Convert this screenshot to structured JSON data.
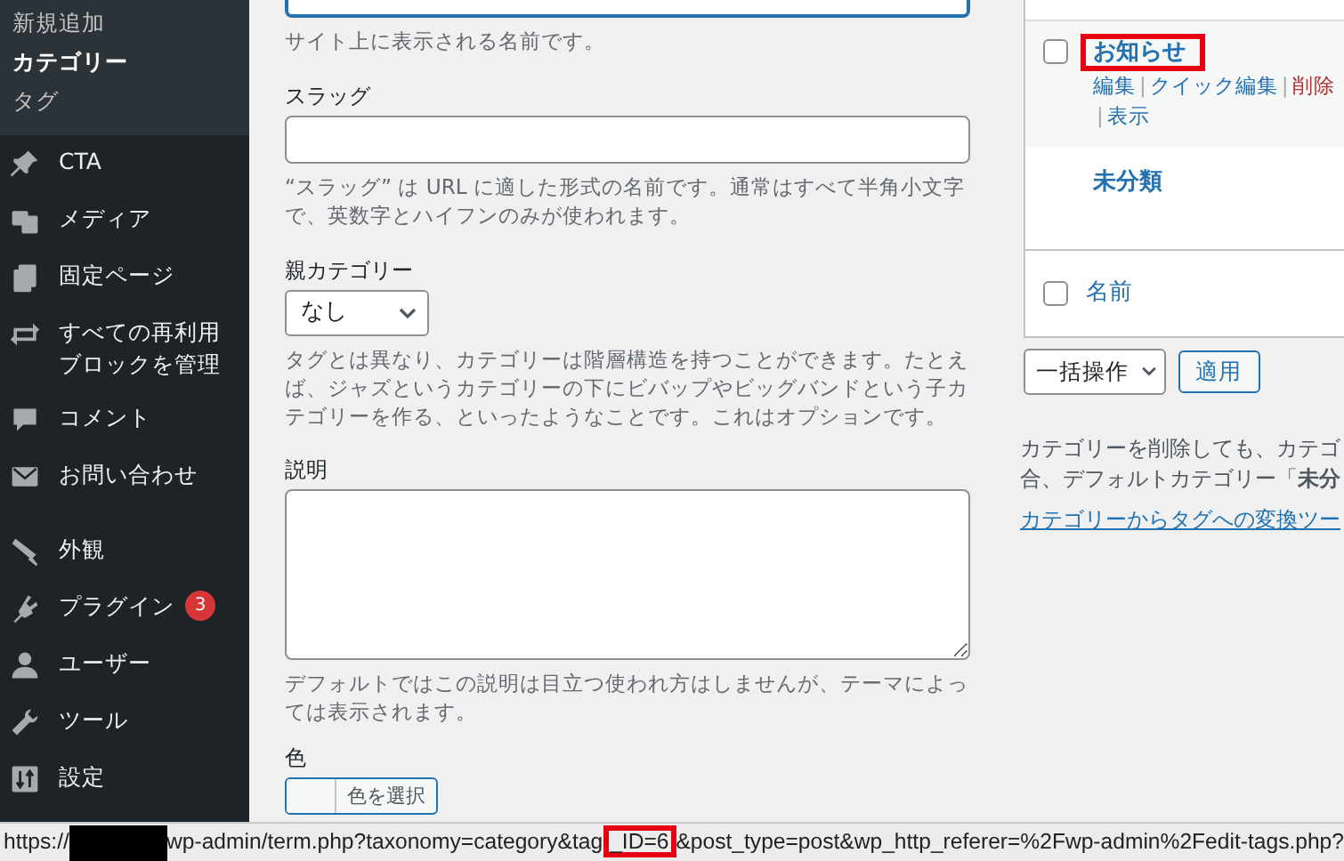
{
  "sidebar": {
    "submenu": [
      {
        "label": "新規追加",
        "selected": false
      },
      {
        "label": "カテゴリー",
        "selected": true
      },
      {
        "label": "タグ",
        "selected": false
      }
    ],
    "menu_groups": [
      [
        {
          "kind": "pin",
          "label": "CTA"
        },
        {
          "kind": "media",
          "label": "メディア"
        },
        {
          "kind": "pages",
          "label": "固定ページ"
        },
        {
          "kind": "blocks",
          "label": "すべての再利用ブロックを管理"
        },
        {
          "kind": "comment",
          "label": "コメント"
        },
        {
          "kind": "mail",
          "label": "お問い合わせ"
        }
      ],
      [
        {
          "kind": "brush",
          "label": "外観"
        },
        {
          "kind": "plug",
          "label": "プラグイン",
          "badge": "3"
        },
        {
          "kind": "user",
          "label": "ユーザー"
        },
        {
          "kind": "wrench",
          "label": "ツール"
        },
        {
          "kind": "settings",
          "label": "設定"
        }
      ]
    ]
  },
  "form": {
    "name_hint": "サイト上に表示される名前です。",
    "slug": {
      "label": "スラッグ",
      "hint": "“スラッグ” は URL に適した形式の名前です。通常はすべて半角小文字で、英数字とハイフンのみが使われます。"
    },
    "parent": {
      "label": "親カテゴリー",
      "value": "なし",
      "hint": "タグとは異なり、カテゴリーは階層構造を持つことができます。たとえば、ジャズというカテゴリーの下にビバップやビッグバンドという子カテゴリーを作る、といったようなことです。これはオプションです。"
    },
    "description": {
      "label": "説明",
      "hint": "デフォルトではこの説明は目立つ使われ方はしませんが、テーマによっては表示されます。"
    },
    "color": {
      "label": "色",
      "button": "色を選択"
    }
  },
  "table": {
    "rows": [
      {
        "name": "お知らせ",
        "checked": false,
        "highlighted": true,
        "action_lines": [
          [
            {
              "kind": "link",
              "label": "編集"
            },
            {
              "kind": "separator",
              "label": "|"
            },
            {
              "kind": "link",
              "label": "クイック編集"
            },
            {
              "kind": "separator",
              "label": "|"
            },
            {
              "kind": "delete",
              "label": "削除"
            }
          ],
          [
            {
              "kind": "separator",
              "label": "|"
            },
            {
              "kind": "link",
              "label": "表示"
            }
          ]
        ]
      },
      {
        "name": "未分類",
        "highlighted": false,
        "action_lines": []
      }
    ],
    "footer": {
      "label": "名前",
      "checked": false
    }
  },
  "bulk": {
    "select": "一括操作",
    "apply": "適用"
  },
  "note": {
    "line_1": "カテゴリーを削除しても、カテゴ",
    "line_2": "合、デフォルトカテゴリー「**未分**",
    "link": "カテゴリーからタグへの変換ツー"
  },
  "status_bar": {
    "prefix": "https://",
    "url_parts": [
      {
        "text": "wp-admin/term.php?taxonomy=category&tag",
        "highlighted": false
      },
      {
        "text": "_ID=6",
        "highlighted": true
      },
      {
        "text": "&post_type=post&wp_http_referer=%2Fwp-admin%2Fedit-tags.php?",
        "highlighted": false
      }
    ]
  }
}
